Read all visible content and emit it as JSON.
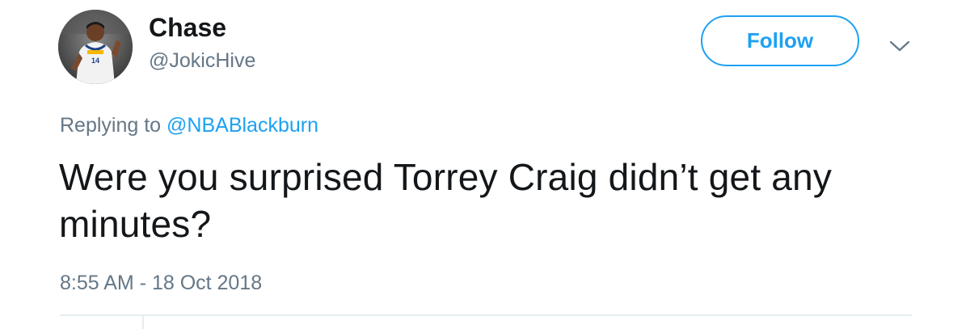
{
  "user": {
    "display_name": "Chase",
    "handle": "@JokicHive",
    "avatar_icon": "player-photo-avatar"
  },
  "actions": {
    "follow_label": "Follow",
    "more_icon": "chevron-down-icon"
  },
  "reply_context": {
    "prefix": "Replying to",
    "mention": "@NBABlackburn"
  },
  "tweet": {
    "text": "Were you surprised Torrey Craig didn’t get any minutes?",
    "timestamp": "8:55 AM - 18 Oct 2018"
  },
  "colors": {
    "accent": "#1da1f2",
    "text": "#14171a",
    "secondary": "#657786",
    "divider": "#e6ecf0"
  }
}
